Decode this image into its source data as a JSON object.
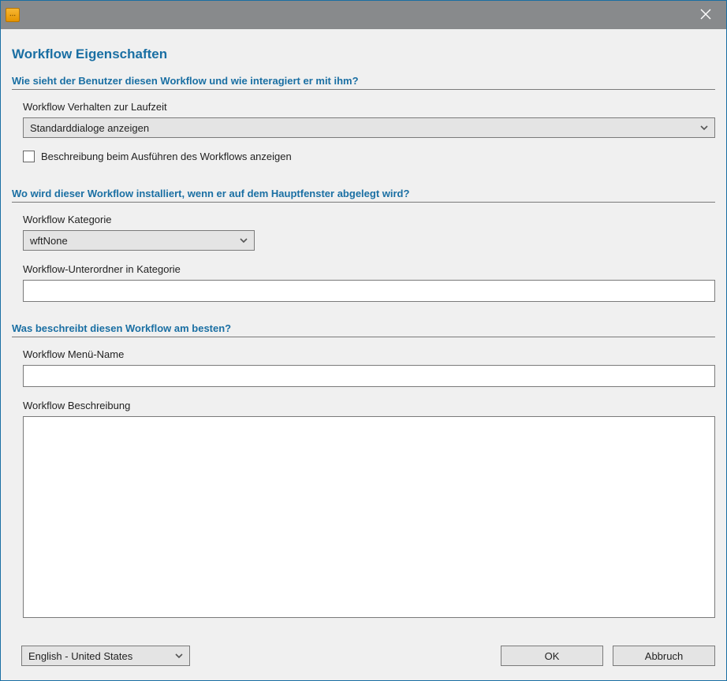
{
  "titlebar": {},
  "dialog": {
    "title": "Workflow Eigenschaften"
  },
  "section1": {
    "heading": "Wie sieht der Benutzer diesen Workflow und wie interagiert er mit ihm?",
    "behavior_label": "Workflow Verhalten zur Laufzeit",
    "behavior_value": "Standarddialoge anzeigen",
    "show_desc_checkbox_label": "Beschreibung beim Ausführen des Workflows anzeigen",
    "show_desc_checked": false
  },
  "section2": {
    "heading": "Wo wird dieser Workflow installiert, wenn er auf dem Hauptfenster abgelegt wird?",
    "category_label": "Workflow Kategorie",
    "category_value": "wftNone",
    "subfolder_label": "Workflow-Unterordner in Kategorie",
    "subfolder_value": ""
  },
  "section3": {
    "heading": "Was beschreibt diesen Workflow am besten?",
    "menu_name_label": "Workflow Menü-Name",
    "menu_name_value": "",
    "description_label": "Workflow Beschreibung",
    "description_value": ""
  },
  "footer": {
    "language_value": "English - United States",
    "ok_label": "OK",
    "cancel_label": "Abbruch"
  }
}
